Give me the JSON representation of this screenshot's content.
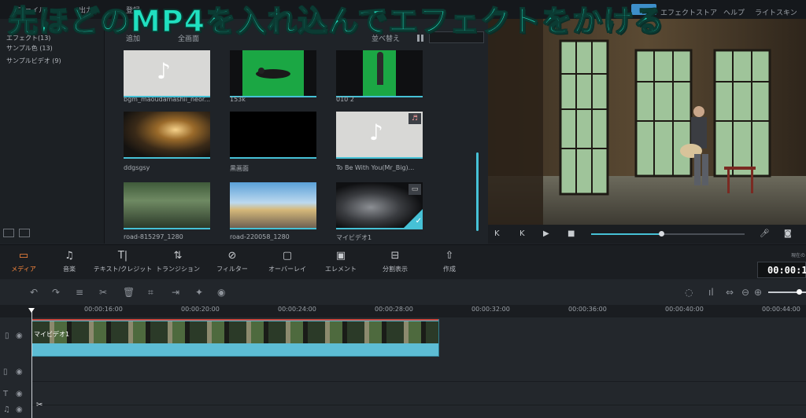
{
  "overlay": {
    "title": "先ほどのMP4を入れ込んでエフェクトをかける"
  },
  "topbar": {
    "menu": [
      "ファイル",
      "出力",
      "登録"
    ],
    "right_items": [
      "エフェクトストア",
      "ヘルプ",
      "ライトスキン"
    ]
  },
  "library": {
    "items": [
      {
        "label": "エフェクト(13)"
      },
      {
        "label": "サンプル色 (13)"
      },
      {
        "label": "サンプルビデオ (9)"
      }
    ]
  },
  "media": {
    "toolbar": {
      "add": "追加",
      "filter": "全画面",
      "sort": "並べ替え"
    },
    "items": [
      {
        "label": "bgm_maoudamashii_neor...",
        "kind": "audio"
      },
      {
        "label": "153k",
        "kind": "video-green"
      },
      {
        "label": "010 2",
        "kind": "video-green"
      },
      {
        "label": "ddgsgsy",
        "kind": "image-hall"
      },
      {
        "label": "黒画面",
        "kind": "black"
      },
      {
        "label": "To Be With You(Mr_Big)...",
        "kind": "audio"
      },
      {
        "label": "road-815297_1280",
        "kind": "image-forest"
      },
      {
        "label": "road-220058_1280",
        "kind": "image-road"
      },
      {
        "label": "マイビデオ1",
        "kind": "video-guitar"
      }
    ]
  },
  "preview": {
    "controls": [
      "K",
      "K",
      "▶",
      "■"
    ]
  },
  "tools": [
    {
      "label": "メディア",
      "icon": "folder-icon",
      "active": true
    },
    {
      "label": "音楽",
      "icon": "music-icon"
    },
    {
      "label": "テキスト/クレジット",
      "icon": "text-icon"
    },
    {
      "label": "トランジション",
      "icon": "transition-icon"
    },
    {
      "label": "フィルター",
      "icon": "filter-icon"
    },
    {
      "label": "オーバーレイ",
      "icon": "overlay-icon"
    },
    {
      "label": "エレメント",
      "icon": "image-icon"
    },
    {
      "label": "分割表示",
      "icon": "split-icon"
    },
    {
      "label": "作成",
      "icon": "export-icon"
    }
  ],
  "timecode": {
    "label": "現在の",
    "value": "00:00:1"
  },
  "ruler": [
    "00:00:16:00",
    "00:00:20:00",
    "00:00:24:00",
    "00:00:28:00",
    "00:00:32:00",
    "00:00:36:00",
    "00:00:40:00",
    "00:00:44:00"
  ],
  "timeline": {
    "clip_label": "マイビデオ1"
  },
  "colors": {
    "accent": "#46c1d6",
    "active": "#ff8a3d",
    "overlay_text": "#20e0c0"
  }
}
